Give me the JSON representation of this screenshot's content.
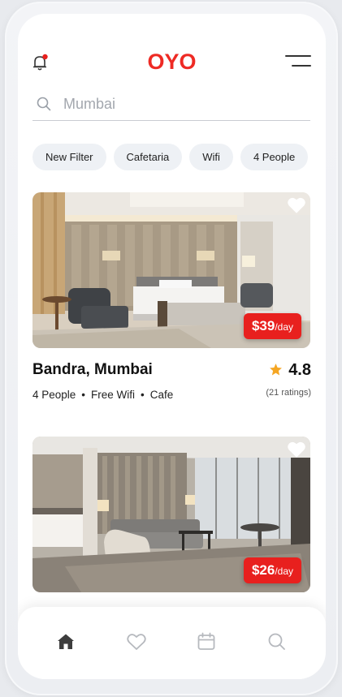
{
  "header": {
    "logo_text": "OYO",
    "logo_color": "#ee2a24",
    "notification_icon": "bell-icon",
    "menu_icon": "menu-icon"
  },
  "search": {
    "placeholder": "Mumbai",
    "icon": "search-icon"
  },
  "filters": [
    {
      "label": "New Filter"
    },
    {
      "label": "Cafetaria"
    },
    {
      "label": "Wifi"
    },
    {
      "label": "4 People"
    }
  ],
  "listings": [
    {
      "title": "Bandra, Mumbai",
      "price": "$39",
      "price_unit": "/day",
      "rating": "4.8",
      "ratings_count": "(21 ratings)",
      "features": [
        "4 People",
        "Free Wifi",
        "Cafe"
      ]
    },
    {
      "price": "$26",
      "price_unit": "/day"
    }
  ],
  "bottom_nav": [
    {
      "icon": "home-icon",
      "active": true
    },
    {
      "icon": "heart-icon",
      "active": false
    },
    {
      "icon": "calendar-icon",
      "active": false
    },
    {
      "icon": "search-icon",
      "active": false
    }
  ],
  "colors": {
    "accent": "#e8201e",
    "star": "#f5a623",
    "chip_bg": "#eef1f5"
  }
}
